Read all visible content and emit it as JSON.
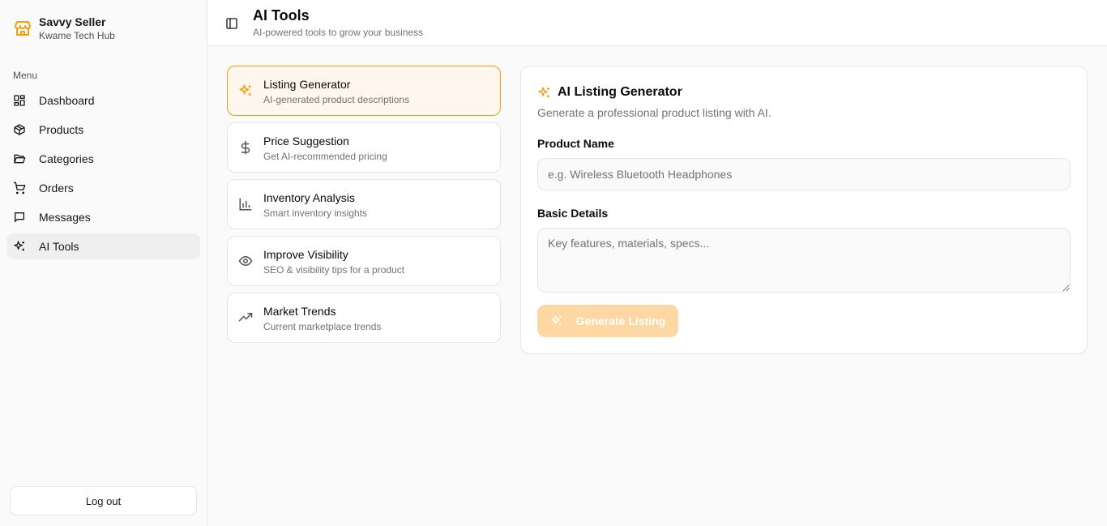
{
  "brand": {
    "name": "Savvy Seller",
    "subtitle": "Kwame Tech Hub"
  },
  "sidebar": {
    "menu_label": "Menu",
    "items": [
      {
        "label": "Dashboard",
        "icon": "dashboard-icon"
      },
      {
        "label": "Products",
        "icon": "box-icon"
      },
      {
        "label": "Categories",
        "icon": "folder-icon"
      },
      {
        "label": "Orders",
        "icon": "cart-icon"
      },
      {
        "label": "Messages",
        "icon": "message-icon"
      },
      {
        "label": "AI Tools",
        "icon": "sparkles-icon",
        "active": true
      }
    ],
    "logout_label": "Log out"
  },
  "header": {
    "title": "AI Tools",
    "subtitle": "AI-powered tools to grow your business"
  },
  "tools": [
    {
      "title": "Listing Generator",
      "desc": "AI-generated product descriptions",
      "icon": "sparkles-icon",
      "active": true
    },
    {
      "title": "Price Suggestion",
      "desc": "Get AI-recommended pricing",
      "icon": "dollar-icon"
    },
    {
      "title": "Inventory Analysis",
      "desc": "Smart inventory insights",
      "icon": "bar-chart-icon"
    },
    {
      "title": "Improve Visibility",
      "desc": "SEO & visibility tips for a product",
      "icon": "eye-icon"
    },
    {
      "title": "Market Trends",
      "desc": "Current marketplace trends",
      "icon": "trending-up-icon"
    }
  ],
  "form": {
    "title": "AI Listing Generator",
    "subtitle": "Generate a professional product listing with AI.",
    "product_name_label": "Product Name",
    "product_name_placeholder": "e.g. Wireless Bluetooth Headphones",
    "product_name_value": "",
    "details_label": "Basic Details",
    "details_placeholder": "Key features, materials, specs...",
    "details_value": "",
    "generate_label": "Generate Listing"
  },
  "colors": {
    "accent": "#f59e0b",
    "accent_light": "#fed7a3",
    "active_bg": "#fff7ed"
  }
}
